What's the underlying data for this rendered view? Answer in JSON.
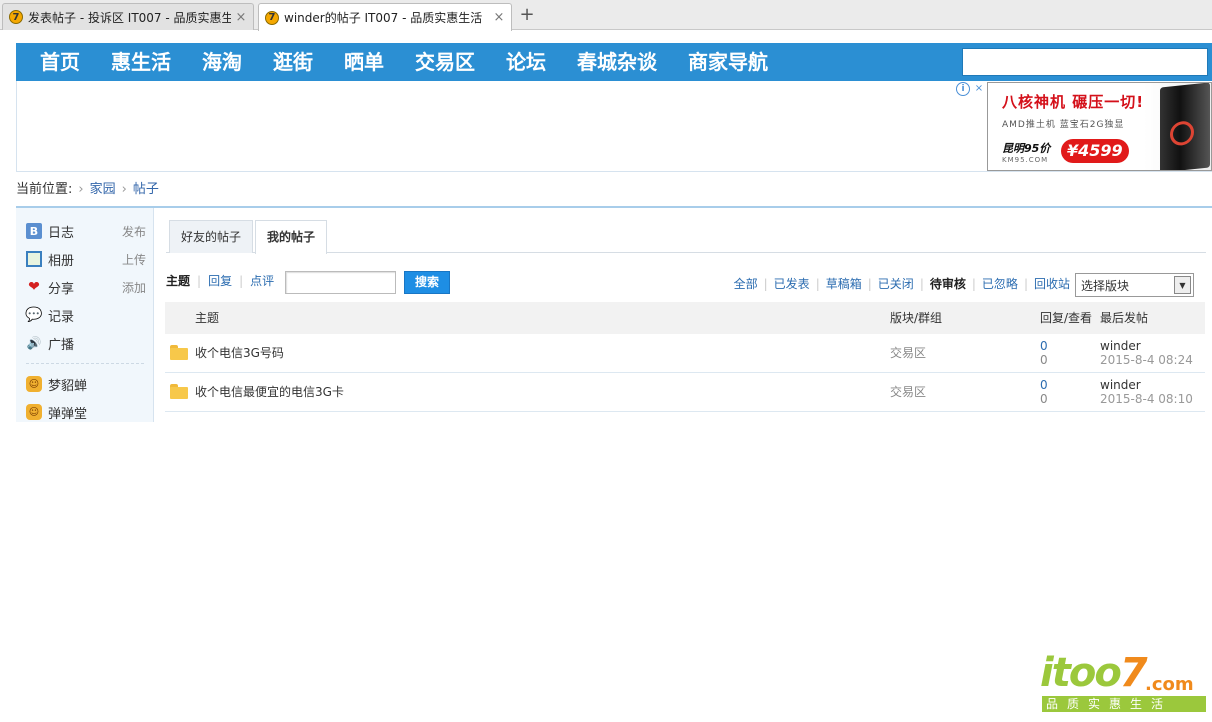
{
  "browser": {
    "tabs": [
      {
        "title": "发表帖子 - 投诉区 IT007 - 品质实惠生",
        "active": false
      },
      {
        "title": "winder的帖子 IT007 - 品质实惠生活",
        "active": true
      }
    ],
    "new_tab_label": "+",
    "close_glyph": "×",
    "favicon_glyph": "7"
  },
  "topnav": {
    "items": [
      "首页",
      "惠生活",
      "海淘",
      "逛街",
      "晒单",
      "交易区",
      "论坛",
      "春城杂谈",
      "商家导航"
    ],
    "search_value": ""
  },
  "ad": {
    "info_glyph": "i",
    "close_glyph": "×",
    "headline": "八核神机 碾压一切!",
    "sub": "AMD推土机 蓝宝石2G独显",
    "price_label": "昆明95价",
    "site": "KM95.COM",
    "price": "¥4599"
  },
  "breadcrumb": {
    "label": "当前位置:",
    "items": [
      "家园",
      "帖子"
    ],
    "separator": "›"
  },
  "sidebar": {
    "items": [
      {
        "label": "日志",
        "action": "发布",
        "icon": "blog-icon",
        "glyph": "B"
      },
      {
        "label": "相册",
        "action": "上传",
        "icon": "album-icon",
        "glyph": ""
      },
      {
        "label": "分享",
        "action": "添加",
        "icon": "share-icon",
        "glyph": "❤"
      },
      {
        "label": "记录",
        "action": "",
        "icon": "record-icon",
        "glyph": "💬"
      },
      {
        "label": "广播",
        "action": "",
        "icon": "broadcast-icon",
        "glyph": "🔊"
      }
    ],
    "apps": [
      {
        "label": "梦貂蝉",
        "icon": "app-mengdiaochan-icon",
        "glyph": "☺"
      },
      {
        "label": "弹弹堂",
        "icon": "app-dandantang-icon",
        "glyph": "☺"
      }
    ]
  },
  "content_tabs": [
    {
      "label": "好友的帖子",
      "active": false
    },
    {
      "label": "我的帖子",
      "active": true
    }
  ],
  "filters": {
    "type_links": [
      {
        "label": "主题",
        "selected": true
      },
      {
        "label": "回复",
        "selected": false
      },
      {
        "label": "点评",
        "selected": false
      }
    ],
    "search_value": "",
    "search_button": "搜索",
    "status_links": [
      {
        "label": "全部",
        "selected": false
      },
      {
        "label": "已发表",
        "selected": false
      },
      {
        "label": "草稿箱",
        "selected": false
      },
      {
        "label": "已关闭",
        "selected": false
      },
      {
        "label": "待审核",
        "selected": true
      },
      {
        "label": "已忽略",
        "selected": false
      },
      {
        "label": "回收站",
        "selected": false
      }
    ],
    "board_select": "选择版块",
    "dropdown_glyph": "▼"
  },
  "table": {
    "headers": {
      "subject": "主题",
      "board": "版块/群组",
      "counts": "回复/查看",
      "last": "最后发帖"
    },
    "rows": [
      {
        "subject": "收个电信3G号码",
        "board": "交易区",
        "replies": "0",
        "views": "0",
        "author": "winder",
        "date": "2015-8-4 08:24"
      },
      {
        "subject": "收个电信最便宜的电信3G卡",
        "board": "交易区",
        "replies": "0",
        "views": "0",
        "author": "winder",
        "date": "2015-8-4 08:10"
      }
    ]
  },
  "watermark": {
    "main_prefix": "itoo",
    "main_seven": "7",
    "dotcom": ".com",
    "tagline": "品质实惠生活"
  },
  "colors": {
    "nav_blue": "#2b8fd3",
    "link_blue": "#2b6cb0",
    "search_button": "#1e8ee4",
    "ad_red": "#e11a1a",
    "logo_green": "#9bc83c",
    "logo_orange": "#f08a1c"
  }
}
